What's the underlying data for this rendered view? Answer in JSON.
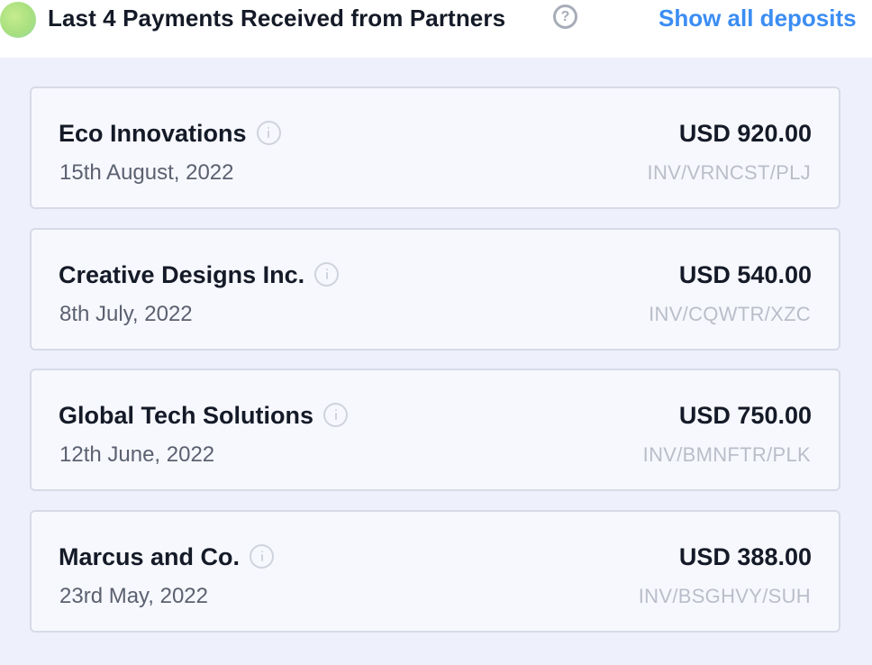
{
  "header": {
    "title": "Last 4 Payments Received from Partners",
    "help_icon": "question-circle-icon",
    "link_label": "Show all deposits",
    "accent_color": "#3b8df3"
  },
  "payments": [
    {
      "partner": "Eco Innovations",
      "date": "15th August, 2022",
      "amount": "USD 920.00",
      "reference": "INV/VRNCST/PLJ",
      "icon": "info-icon"
    },
    {
      "partner": "Creative Designs Inc.",
      "date": "8th July, 2022",
      "amount": "USD 540.00",
      "reference": "INV/CQWTR/XZC",
      "icon": "info-icon"
    },
    {
      "partner": "Global Tech Solutions",
      "date": "12th June, 2022",
      "amount": "USD 750.00",
      "reference": "INV/BMNFTR/PLK",
      "icon": "info-icon"
    },
    {
      "partner": "Marcus and Co.",
      "date": "23rd May, 2022",
      "amount": "USD 388.00",
      "reference": "INV/BSGHVY/SUH",
      "icon": "info-icon"
    }
  ]
}
